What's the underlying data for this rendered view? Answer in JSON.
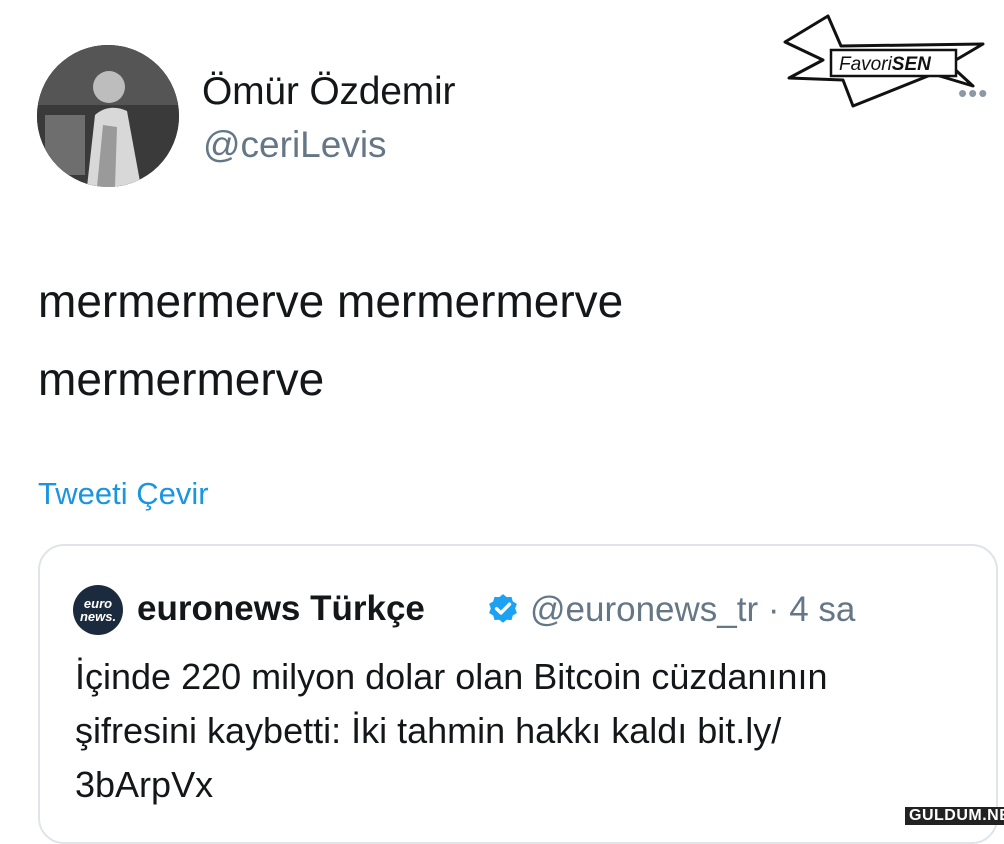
{
  "author": {
    "name": "Ömür Özdemir",
    "handle": "@ceriLevis"
  },
  "badge": {
    "text_plain": "Favori",
    "text_bold": "SEN"
  },
  "more_icon": "more-dots-icon",
  "tweet": {
    "line1": "mermermerve mermermerve",
    "line2": "mermermerve"
  },
  "translate_link": "Tweeti Çevir",
  "quoted": {
    "logo_top": "euro",
    "logo_bottom": "news.",
    "name": "euronews Türkçe",
    "handle_time": "@euronews_tr · 4 sa",
    "line1": "İçinde 220 milyon dolar olan Bitcoin cüzdanının",
    "line2": "şifresini kaybetti: İki tahmin hakkı kaldı  bit.ly/",
    "line3": "3bArpVx"
  },
  "watermark": "GULDUM.NET",
  "colors": {
    "link": "#1b95e0",
    "muted": "#657786",
    "verified": "#1da1f2"
  }
}
